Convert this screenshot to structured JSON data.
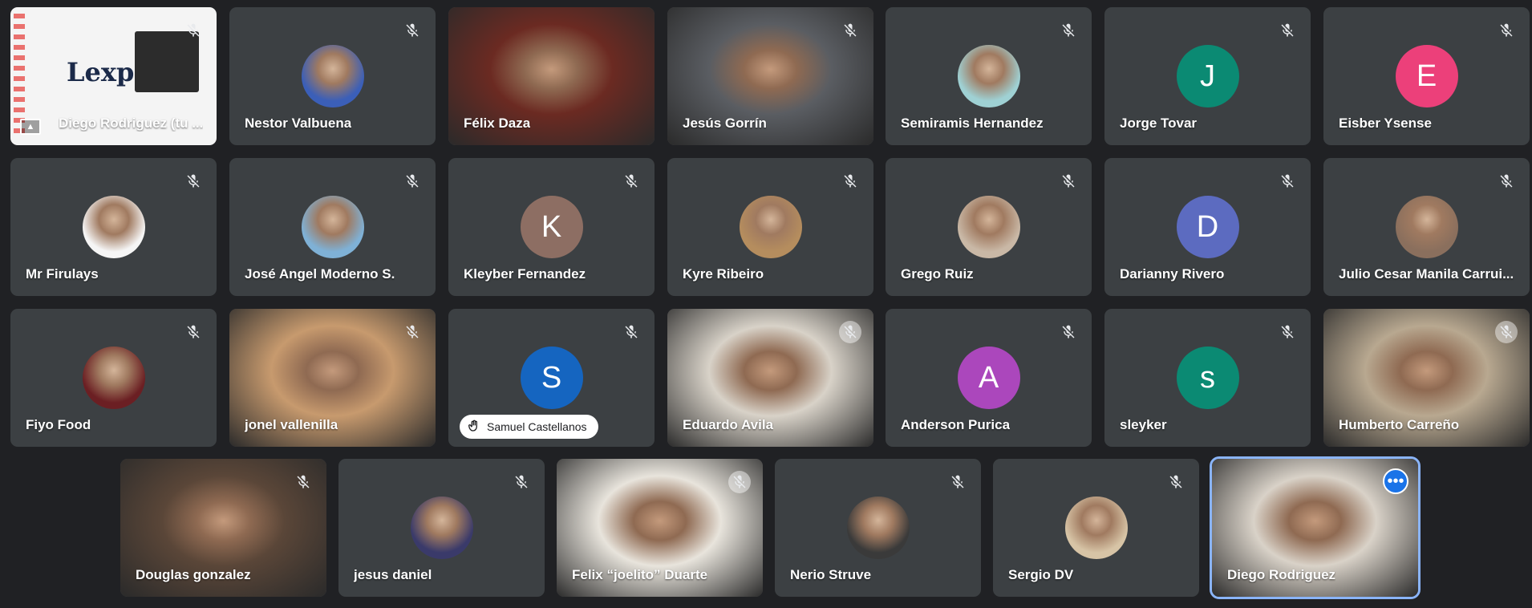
{
  "participants": [
    {
      "name": "Diego Rodriguez (tu ...",
      "type": "screen",
      "screen_text": "Lexpi",
      "mic": "muted"
    },
    {
      "name": "Nestor Valbuena",
      "type": "avatar-photo",
      "color": "#3b5fb8",
      "mic": "muted"
    },
    {
      "name": "Félix Daza",
      "type": "video",
      "color": "#6b2a22",
      "mic": "none"
    },
    {
      "name": "Jesús Gorrín",
      "type": "video",
      "color": "#5a5d62",
      "mic": "muted"
    },
    {
      "name": "Semiramis Hernandez",
      "type": "avatar-photo",
      "color": "#9fd1d4",
      "mic": "muted"
    },
    {
      "name": "Jorge Tovar",
      "type": "avatar-letter",
      "letter": "J",
      "color": "#0b8a73",
      "mic": "muted"
    },
    {
      "name": "Eisber Ysense",
      "type": "avatar-letter",
      "letter": "E",
      "color": "#ec407a",
      "mic": "muted"
    },
    {
      "name": "Mr Firulays",
      "type": "avatar-photo",
      "color": "#f5f5f5",
      "mic": "muted"
    },
    {
      "name": "José Angel Moderno S.",
      "type": "avatar-photo",
      "color": "#7fb1d6",
      "mic": "muted"
    },
    {
      "name": "Kleyber Fernandez",
      "type": "avatar-letter",
      "letter": "K",
      "color": "#8d6e63",
      "mic": "muted"
    },
    {
      "name": "Kyre Ribeiro",
      "type": "avatar-photo",
      "color": "#b58d5e",
      "mic": "muted"
    },
    {
      "name": "Grego Ruiz",
      "type": "avatar-photo",
      "color": "#c9b8a6",
      "mic": "muted"
    },
    {
      "name": "Darianny Rivero",
      "type": "avatar-letter",
      "letter": "D",
      "color": "#5c6bc0",
      "mic": "muted"
    },
    {
      "name": "Julio Cesar Manila Carrui...",
      "type": "avatar-photo",
      "color": "#8a6f5d",
      "mic": "muted"
    },
    {
      "name": "Fiyo Food",
      "type": "avatar-photo",
      "color": "#6b1f23",
      "mic": "muted"
    },
    {
      "name": "jonel vallenilla",
      "type": "video",
      "color": "#c79a6e",
      "mic": "muted"
    },
    {
      "name": "Samuel Castellanos",
      "type": "avatar-letter",
      "letter": "S",
      "color": "#1565c0",
      "mic": "muted",
      "hand_raised": true
    },
    {
      "name": "Eduardo Avila",
      "type": "video",
      "color": "#d8d2c8",
      "mic": "muted-light"
    },
    {
      "name": "Anderson Purica",
      "type": "avatar-letter",
      "letter": "A",
      "color": "#ab47bc",
      "mic": "muted"
    },
    {
      "name": "sleyker",
      "type": "avatar-letter",
      "letter": "s",
      "color": "#0b8a73",
      "mic": "muted"
    },
    {
      "name": "Humberto Carreño",
      "type": "video",
      "color": "#b8a890",
      "mic": "muted-light"
    },
    {
      "name": "Douglas gonzalez",
      "type": "video",
      "color": "#5a4638",
      "mic": "muted"
    },
    {
      "name": "jesus daniel",
      "type": "avatar-photo",
      "color": "#3a3a6a",
      "mic": "muted"
    },
    {
      "name": "Felix “joelito” Duarte",
      "type": "video",
      "color": "#e8e4dc",
      "mic": "muted-light"
    },
    {
      "name": "Nerio Struve",
      "type": "avatar-photo",
      "color": "#3a3a3a",
      "mic": "muted"
    },
    {
      "name": "Sergio DV",
      "type": "avatar-photo",
      "color": "#d7c4a6",
      "mic": "muted"
    },
    {
      "name": "Diego Rodriguez",
      "type": "video",
      "color": "#d9d2c8",
      "mic": "none",
      "selected": true,
      "more_button": "•••"
    }
  ],
  "colors": {
    "background": "#202124",
    "tile": "#3c4043",
    "selection": "#8ab4f8",
    "more_button": "#1a73e8"
  },
  "icons": {
    "mic_muted": "mic-off-icon",
    "hand": "hand-raised-icon",
    "more": "more-options-icon",
    "present": "presentation-icon"
  }
}
